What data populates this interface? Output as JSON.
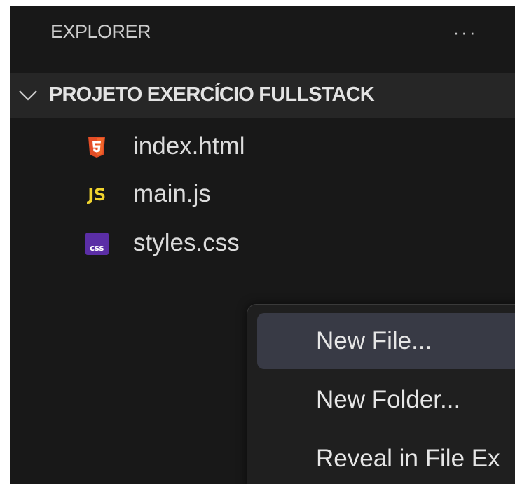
{
  "explorer": {
    "title": "EXPLORER",
    "more_label": "···"
  },
  "project": {
    "name": "PROJETO EXERCÍCIO FULLSTACK",
    "expanded": true
  },
  "files": [
    {
      "name": "index.html",
      "icon": "html5-icon",
      "icon_color": "#e44d26"
    },
    {
      "name": "main.js",
      "icon": "js-icon",
      "icon_text": "JS",
      "icon_color": "#f1d42e"
    },
    {
      "name": "styles.css",
      "icon": "css-icon",
      "icon_text": "css",
      "icon_color": "#5b2ea6"
    }
  ],
  "context_menu": {
    "items": [
      {
        "label": "New File...",
        "active": true
      },
      {
        "label": "New Folder...",
        "active": false
      },
      {
        "label": "Reveal in File Ex",
        "active": false
      }
    ]
  },
  "colors": {
    "panel_bg": "#181818",
    "project_row_bg": "#262626",
    "menu_bg": "#1f1f1f",
    "menu_active_bg": "#383a45",
    "text": "#cccccc"
  }
}
